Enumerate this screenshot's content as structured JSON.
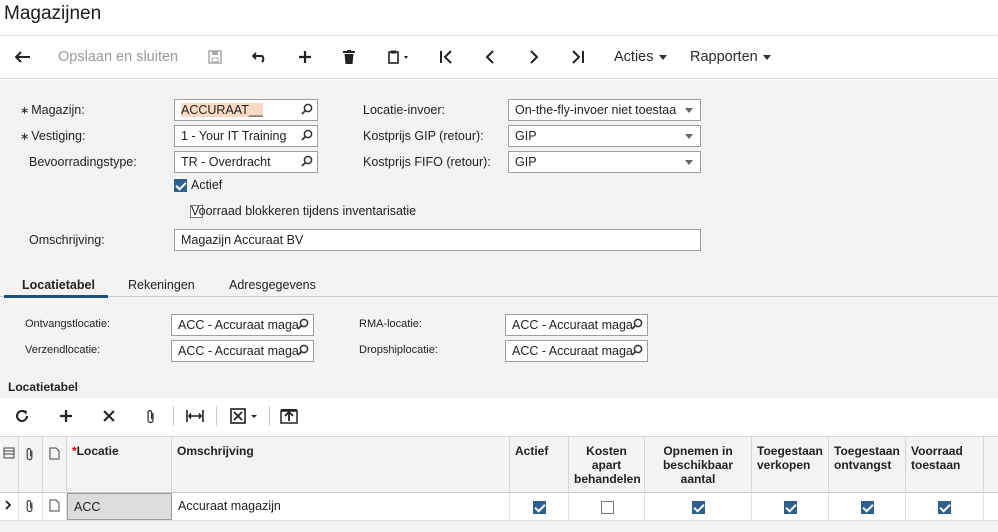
{
  "page": {
    "title": "Magazijnen"
  },
  "toolbar": {
    "save_close": "Opslaan en sluiten",
    "actions": "Acties",
    "reports": "Rapporten"
  },
  "form": {
    "warehouse": {
      "label": "Magazijn:",
      "value": "ACCURAAT__"
    },
    "branch": {
      "label": "Vestiging:",
      "value": "1 - Your IT Training"
    },
    "replenishment": {
      "label": "Bevoorradingstype:",
      "value": "TR - Overdracht"
    },
    "active": {
      "label": "Actief",
      "checked": true
    },
    "block_stock": {
      "label": "Voorraad blokkeren tijdens inventarisatie",
      "checked": false
    },
    "description": {
      "label": "Omschrijving:",
      "value": "Magazijn Accuraat BV"
    },
    "location_entry": {
      "label": "Locatie-invoer:",
      "value": "On-the-fly-invoer niet toestaa"
    },
    "cost_gip": {
      "label": "Kostprijs GIP (retour):",
      "value": "GIP"
    },
    "cost_fifo": {
      "label": "Kostprijs FIFO (retour):",
      "value": "GIP"
    }
  },
  "tabs": [
    "Locatietabel",
    "Rekeningen",
    "Adresgegevens"
  ],
  "locations": {
    "receipt": {
      "label": "Ontvangstlocatie:",
      "value": "ACC - Accuraat maga"
    },
    "shipping": {
      "label": "Verzendlocatie:",
      "value": "ACC - Accuraat maga"
    },
    "rma": {
      "label": "RMA-locatie:",
      "value": "ACC - Accuraat maga"
    },
    "dropship": {
      "label": "Dropshiplocatie:",
      "value": "ACC - Accuraat maga"
    }
  },
  "grid": {
    "title": "Locatietabel",
    "columns": {
      "location": "Locatie",
      "description": "Omschrijving",
      "active": "Actief",
      "cost_separate": "Kosten apart behandelen",
      "include_available": "Opnemen in beschikbaar aantal",
      "allow_sales": "Toegestaan verkopen",
      "allow_receipt": "Toegestaan ontvangst",
      "stock_allowed": "Voorraad toestaan"
    },
    "rows": [
      {
        "location": "ACC",
        "description": "Accuraat magazijn",
        "active": true,
        "cost_separate": false,
        "include_available": true,
        "allow_sales": true,
        "allow_receipt": true,
        "stock_allowed": true
      }
    ]
  },
  "colors": {
    "accent": "#1f4f7f",
    "highlight": "#f7d9c4"
  }
}
